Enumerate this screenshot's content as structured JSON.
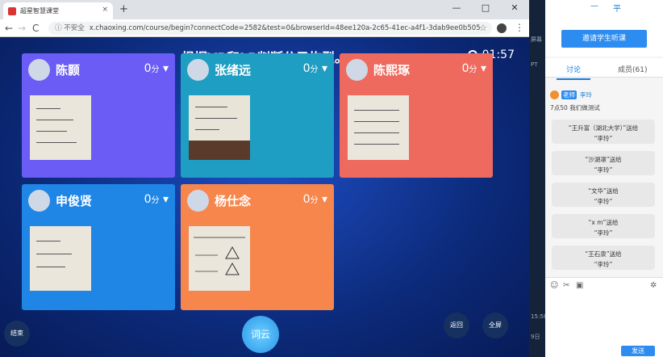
{
  "browser": {
    "tab_title": "超星智慧课堂",
    "tab_close": "×",
    "new_tab": "+",
    "min": "—",
    "max": "□",
    "close": "✕",
    "back": "←",
    "forward": "→",
    "reload": "C",
    "not_secure": "ⓘ 不安全",
    "url": "x.chaoxing.com/course/begin?connectCode=2582&test=0&browserId=48ee120a-2c65-41ec-a4f1-3dab9ee0b505",
    "star": "☆",
    "menu": "⋮"
  },
  "page": {
    "title": "根据VP和LP判断分子构型。",
    "timer": "01:57",
    "cards": [
      {
        "name": "陈颢",
        "score": "0",
        "unit": "分",
        "color": "#6a5cf5"
      },
      {
        "name": "张绪远",
        "score": "0",
        "unit": "分",
        "color": "#1d9ec2"
      },
      {
        "name": "陈熙琢",
        "score": "0",
        "unit": "分",
        "color": "#ee6a5f"
      },
      {
        "name": "申俊贤",
        "score": "0",
        "unit": "分",
        "color": "#1f86e6"
      },
      {
        "name": "杨仕念",
        "score": "0",
        "unit": "分",
        "color": "#f7864d"
      }
    ],
    "end_btn": "结束",
    "ciyun_btn": "词云",
    "back_btn": "返回",
    "full_btn": "全屏"
  },
  "sidebar": {
    "tb1": "—",
    "tb2": "平",
    "invite": "邀请学生听课",
    "tab_discuss": "讨论",
    "tab_members": "成员(61)",
    "teacher_badge": "老师",
    "teacher_name": "李玲",
    "notice": "7点50 我们做测试",
    "gifts": [
      {
        "from": "“王升富（湖北大学）”送给",
        "to": "“李玲”"
      },
      {
        "from": "“沙湖凛”送给",
        "to": "“李玲”"
      },
      {
        "from": "“文华”送给",
        "to": "“李玲”"
      },
      {
        "from": "“x m”送给",
        "to": "“李玲”"
      },
      {
        "from": "“王石泉”送给",
        "to": "“李玲”"
      }
    ],
    "send": "发送"
  },
  "strip": {
    "a": "屏幕",
    "b": "PT",
    "c": "15:58",
    "d": "9日"
  }
}
